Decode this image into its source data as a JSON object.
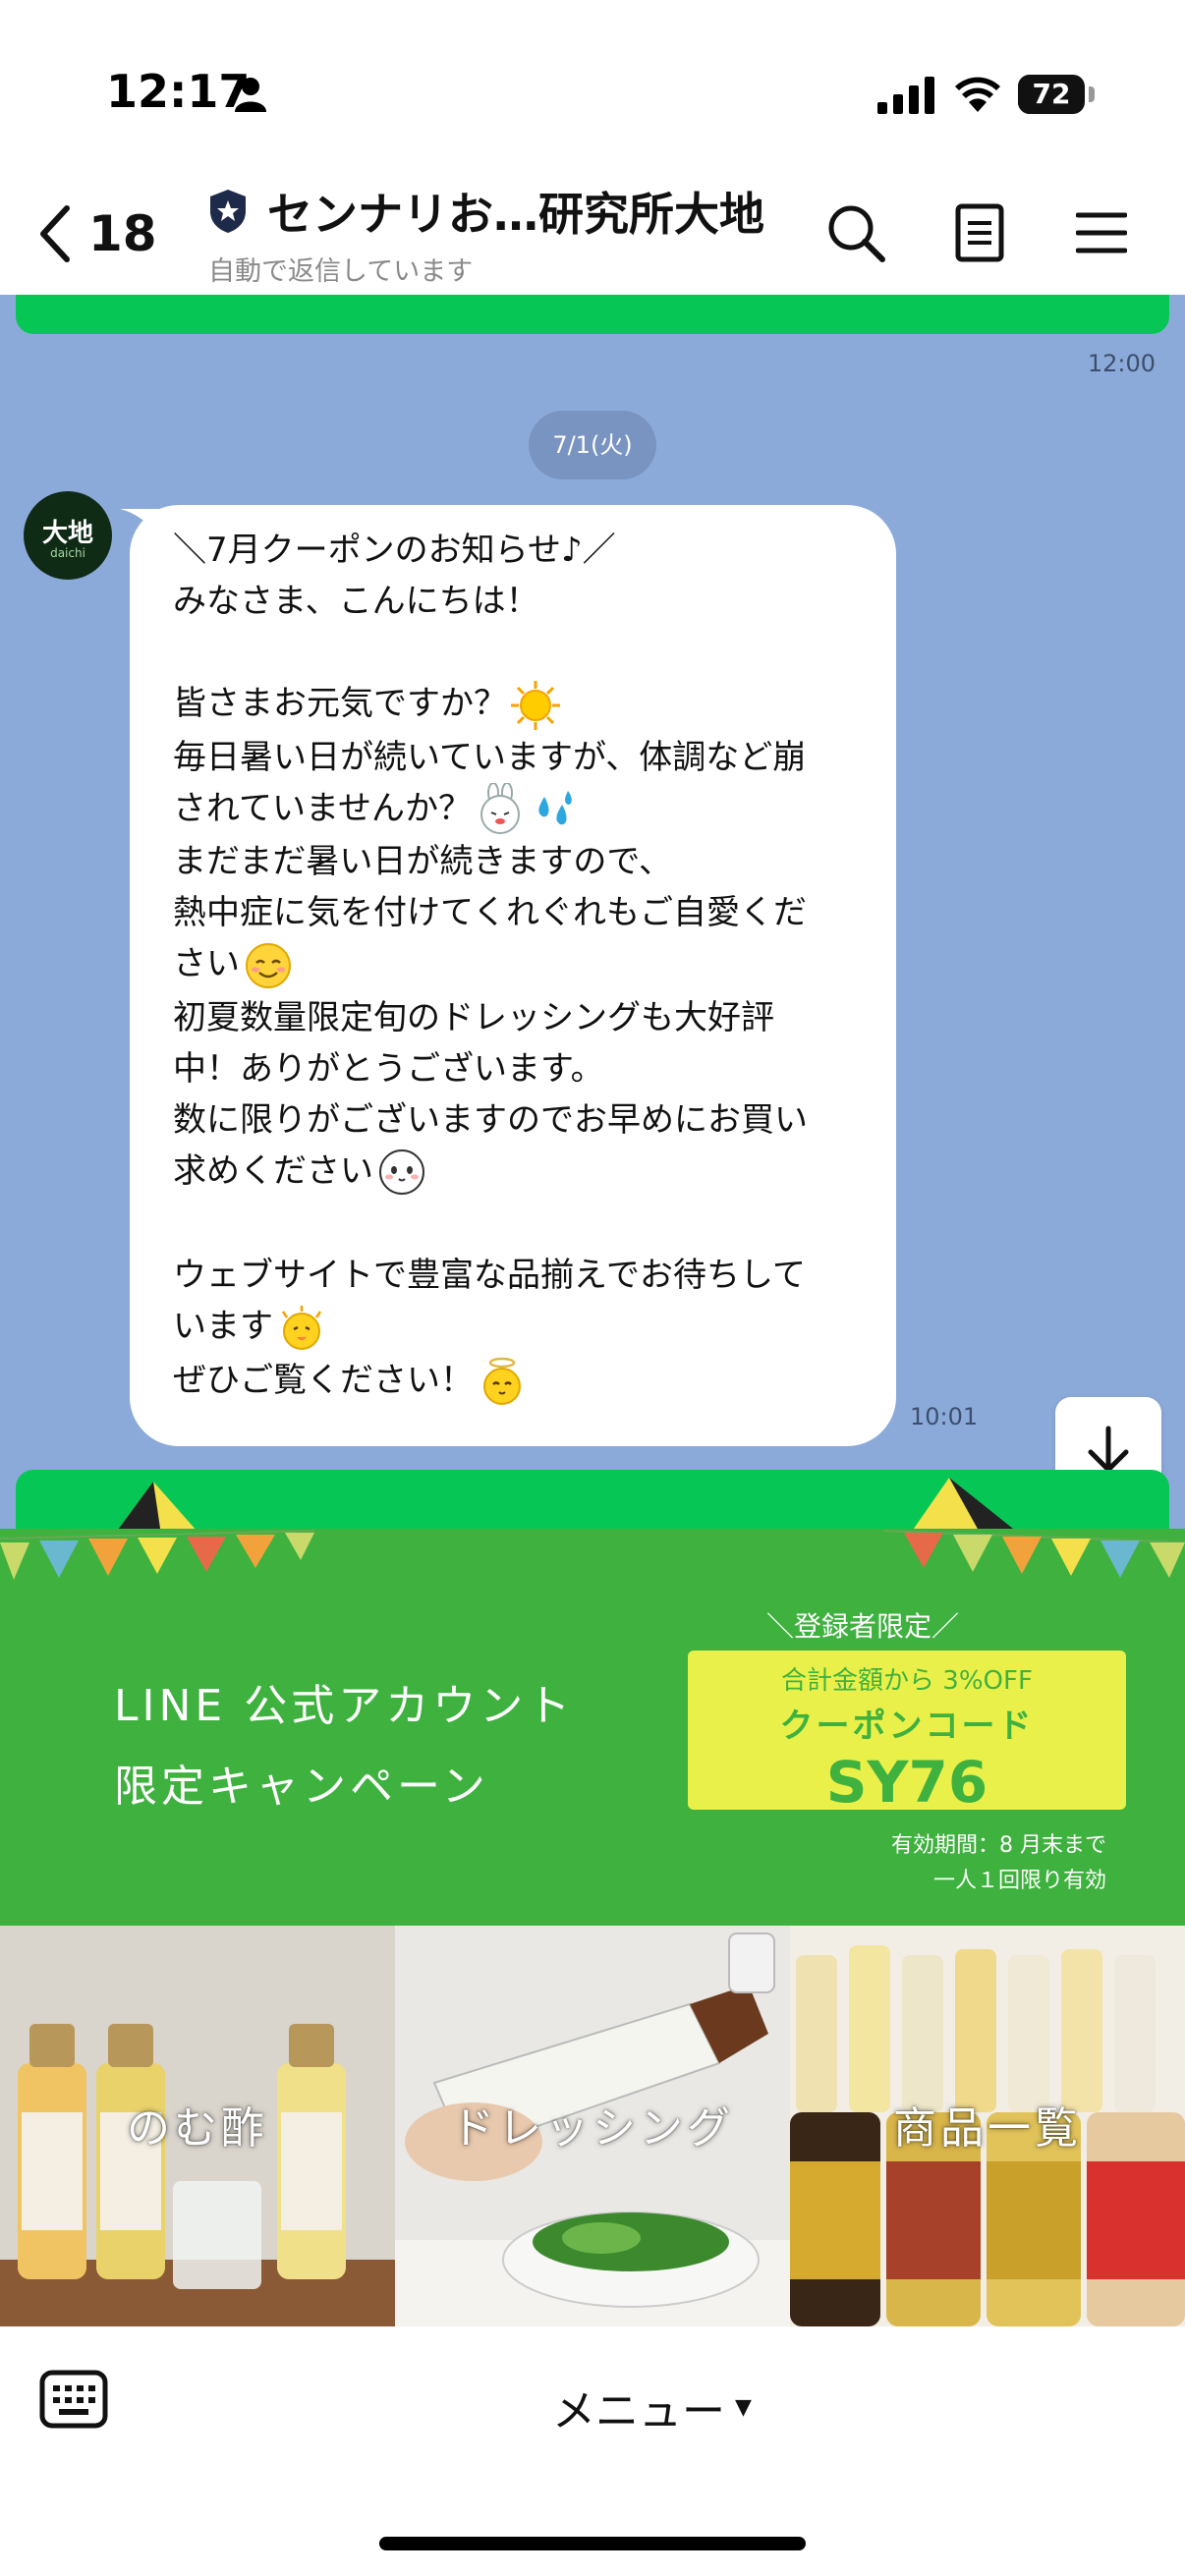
{
  "status_bar": {
    "time": "12:17",
    "battery_percent": "72",
    "battery_level": 0.72,
    "icons": [
      "person-icon",
      "signal-icon",
      "wifi-icon",
      "battery-icon"
    ]
  },
  "header": {
    "back_count": "18",
    "title": "センナリお…研究所大地",
    "subtitle": "自動で返信しています",
    "icons": [
      "chevron-left-icon",
      "official-badge-icon",
      "search-icon",
      "notes-icon",
      "menu-icon"
    ]
  },
  "chat": {
    "prev_time": "12:00",
    "date_chip": "7/1(火)",
    "avatar_text": "大地",
    "avatar_sub": "daichi",
    "message_lines": [
      "＼7月クーポンのお知らせ♪／",
      "みなさま、こんにちは！",
      "",
      "皆さまお元気ですか？",
      "毎日暑い日が続いていますが、体調など崩",
      "されていませんか？",
      "まだまだ暑い日が続きますので、",
      "熱中症に気を付けてくれぐれもご自愛くだ",
      "さい",
      "初夏数量限定旬のドレッシングも大好評",
      "中！ありがとうございます。",
      "数に限りがございますのでお早めにお買い",
      "求めください",
      "",
      "ウェブサイトで豊富な品揃えでお待ちして",
      "います",
      "ぜひご覧ください！"
    ],
    "message_time": "10:01",
    "emojis": [
      "sun-emoji",
      "rabbit-emoji",
      "sweat-drops-emoji",
      "smiling-face-emoji",
      "face-emoji",
      "chick-emoji",
      "chick-halo-emoji"
    ]
  },
  "rich_menu": {
    "banner_title_line1": "LINE 公式アカウント",
    "banner_title_line2": "限定キャンペーン",
    "badge_head": "＼登録者限定／",
    "coupon_line1": "合計金額から 3%OFF",
    "coupon_line2": "クーポンコード",
    "coupon_code": "SY76",
    "validity": "有効期間：8 月末まで",
    "limit": "一人１回限り有効",
    "tiles": [
      {
        "label": "のむ酢"
      },
      {
        "label": "ドレッシング"
      },
      {
        "label": "商品一覧"
      }
    ]
  },
  "bottom_bar": {
    "menu_label": "メニュー",
    "caret": "▼"
  },
  "colors": {
    "line_green": "#06c755",
    "chat_bg": "#8caad9",
    "banner_green": "#3fb13f",
    "coupon_yellow": "#eaf04a"
  }
}
